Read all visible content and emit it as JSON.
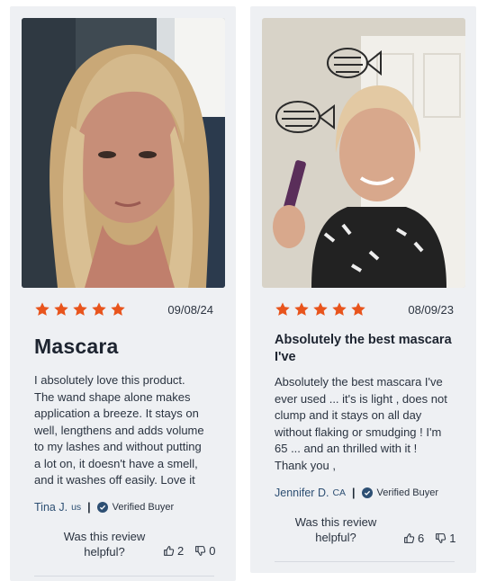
{
  "reviews": [
    {
      "rating": 5,
      "date": "09/08/24",
      "title": "Mascara",
      "body": "I absolutely love this product.\nThe wand shape alone makes\napplication a breeze. It stays on\nwell, lengthens and adds volume\nto my lashes and without putting\na lot on, it doesn't have a smell,\nand it washes off easily. Love it",
      "author": "Tina J.",
      "location": "us",
      "badge": "Verified Buyer",
      "helpful_label": "Was this review helpful?",
      "upvotes": "2",
      "downvotes": "0"
    },
    {
      "rating": 5,
      "date": "08/09/23",
      "title": "Absolutely the best mascara I've",
      "body": "Absolutely the best mascara I've\never used ... it's is light , does not\nclump and it stays on all day\nwithout flaking or smudging ! I'm\n65 ... and an thrilled with it !\nThank you ,",
      "author": "Jennifer D.",
      "location": "CA",
      "badge": "Verified Buyer",
      "helpful_label": "Was this review helpful?",
      "upvotes": "6",
      "downvotes": "1"
    }
  ],
  "colors": {
    "star": "#e8541c",
    "card_bg": "#eef0f3",
    "author": "#2d4f73",
    "verified_icon": "#2d4f73"
  },
  "icons": {
    "star": "star-icon",
    "verified": "check-circle-icon",
    "upvote": "thumbs-up-icon",
    "downvote": "thumbs-down-icon"
  }
}
